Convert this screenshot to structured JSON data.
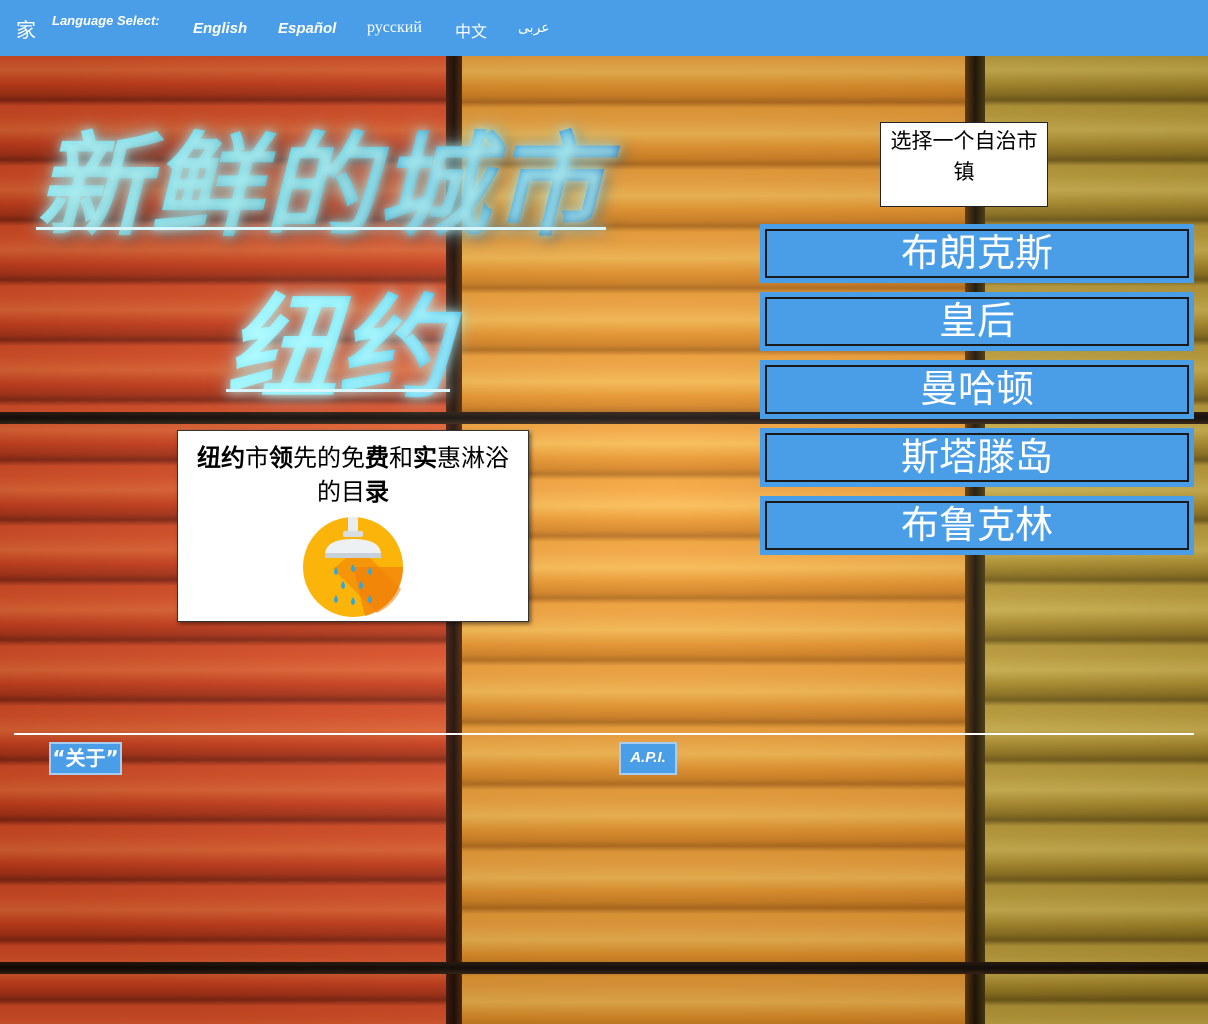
{
  "nav": {
    "home_label": "家",
    "language_select_label": "Language Select:",
    "languages": [
      "English",
      "Español",
      "русский",
      "中文",
      "عربى"
    ]
  },
  "hero": {
    "title": "新鲜的城市",
    "subtitle": "纽约"
  },
  "intro": {
    "segments": [
      "纽约",
      "市",
      "领",
      "先的免",
      "费",
      "和",
      "实",
      "惠淋浴的目",
      "录"
    ],
    "icon": "shower-icon"
  },
  "borough_select": {
    "label": "选择一个自治市镇",
    "boroughs": [
      "布朗克斯",
      "皇后",
      "曼哈顿",
      "斯塔滕岛",
      "布鲁克林"
    ]
  },
  "footer": {
    "about_label": "“关于”",
    "api_label": "A.P.I."
  },
  "colors": {
    "nav_blue": "#4a9ee8",
    "title_gradient_start": "#7ff0ff",
    "title_gradient_end": "#1354c4",
    "white": "#ffffff"
  }
}
